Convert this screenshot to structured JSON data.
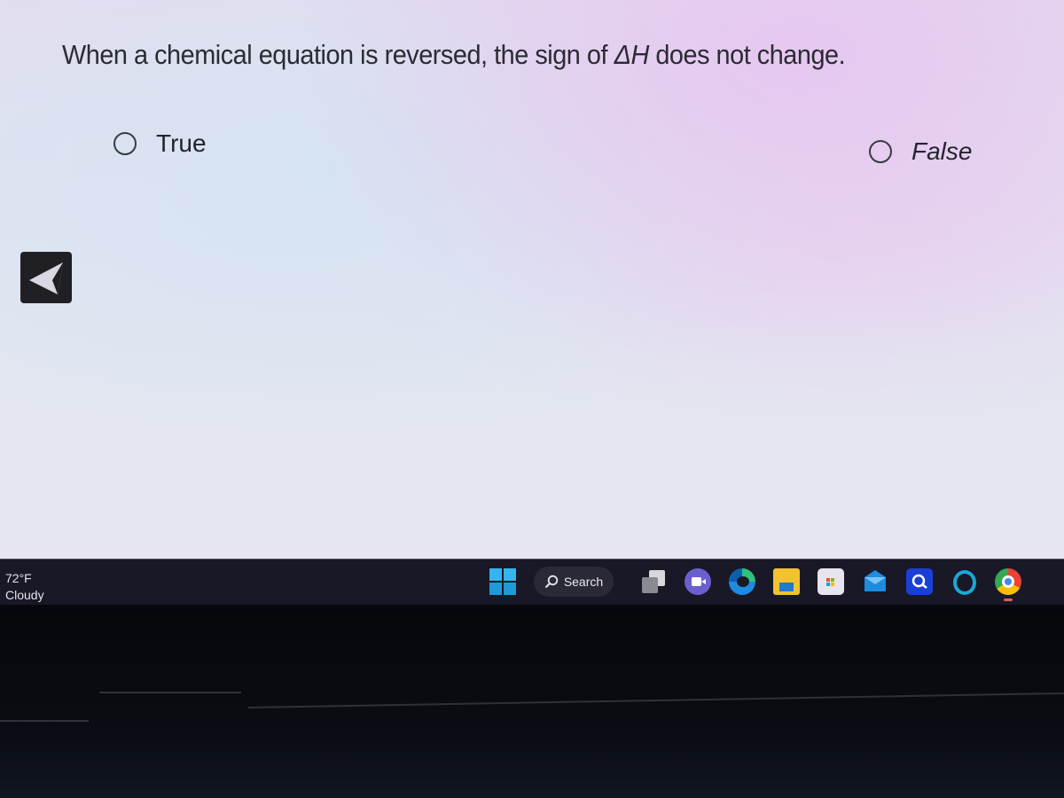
{
  "question": {
    "text_before": "When a chemical equation is reversed, the sign of ",
    "symbol": "ΔH",
    "text_after": " does not change."
  },
  "options": [
    {
      "label": "True",
      "selected": false
    },
    {
      "label": "False",
      "selected": false
    }
  ],
  "navigation": {
    "back_icon": "back-arrow-icon"
  },
  "taskbar": {
    "weather": {
      "temperature": "72°F",
      "condition": "Cloudy"
    },
    "search_label": "Search",
    "apps": [
      "start",
      "task-view",
      "teams-meet",
      "edge",
      "file-explorer",
      "microsoft-store",
      "mail",
      "app-blue",
      "cortana",
      "chrome"
    ],
    "colors": {
      "start": "#29a7e8",
      "edge": "#1f8be0",
      "chrome_active_indicator": "#e0605a"
    }
  }
}
